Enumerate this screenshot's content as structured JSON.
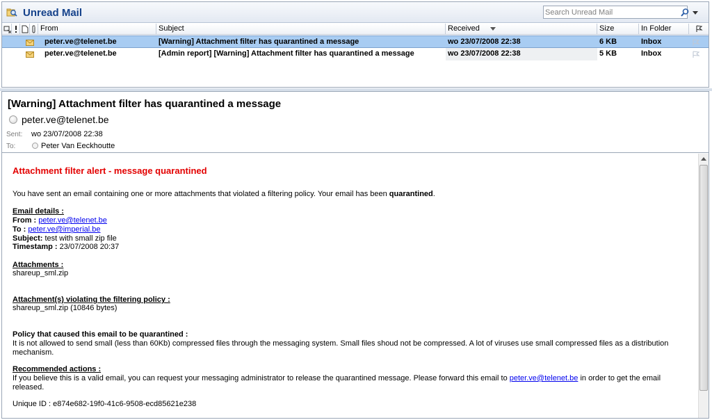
{
  "folder": {
    "title": "Unread Mail",
    "search_placeholder": "Search Unread Mail"
  },
  "columns": {
    "from": "From",
    "subject": "Subject",
    "received": "Received",
    "size": "Size",
    "in_folder": "In Folder"
  },
  "messages": [
    {
      "from": "peter.ve@telenet.be",
      "subject": "[Warning] Attachment filter has quarantined a message",
      "received": "wo 23/07/2008 22:38",
      "size": "6 KB",
      "folder": "Inbox"
    },
    {
      "from": "peter.ve@telenet.be",
      "subject": "[Admin report] [Warning] Attachment filter has quarantined a message",
      "received": "wo 23/07/2008 22:38",
      "size": "5 KB",
      "folder": "Inbox"
    }
  ],
  "reading": {
    "subject": "[Warning] Attachment filter has quarantined a message",
    "sender": "peter.ve@telenet.be",
    "sent_label": "Sent:",
    "sent_value": "wo 23/07/2008 22:38",
    "to_label": "To:",
    "to_value": "Peter Van Eeckhoutte"
  },
  "body": {
    "alert_title": "Attachment filter alert - message quarantined",
    "intro": "You have sent an email containing one or more attachments that violated a filtering policy. Your email has been ",
    "intro_bold": "quarantined",
    "intro_end": ".",
    "details_heading": "Email details :",
    "from_label": "From :",
    "from_value": "peter.ve@telenet.be",
    "to_label": "To :",
    "to_value": "peter.ve@imperial.be",
    "subject_label": "Subject:",
    "subject_value": "test with small zip file",
    "timestamp_label": "Timestamp :",
    "timestamp_value": "23/07/2008 20:37",
    "attachments_heading": "Attachments :",
    "attachments_value": "shareup_sml.zip",
    "violating_heading": "Attachment(s) violating the filtering policy :",
    "violating_value": "shareup_sml.zip (10846 bytes)",
    "policy_heading": "Policy that caused this email to be quarantined :",
    "policy_text": "It is not allowed to send small (less than 60Kb) compressed files through the messaging system. Small files shoud not be compressed. A lot of viruses use small compressed files as a distribution mechanism.",
    "actions_heading": "Recommended actions :",
    "actions_text_1": "If you believe this is a valid email, you can request your messaging administrator to release the quarantined message. Please forward this email to ",
    "actions_link": "peter.ve@telenet.be",
    "actions_text_2": " in order to get the email released.",
    "unique_id": "Unique ID : e874e682-19f0-41c6-9508-ecd85621e238"
  },
  "colors": {
    "accent_title": "#15428b",
    "alert_red": "#e30000",
    "selected_row": "#a8ccf2",
    "link": "#0000ee"
  }
}
